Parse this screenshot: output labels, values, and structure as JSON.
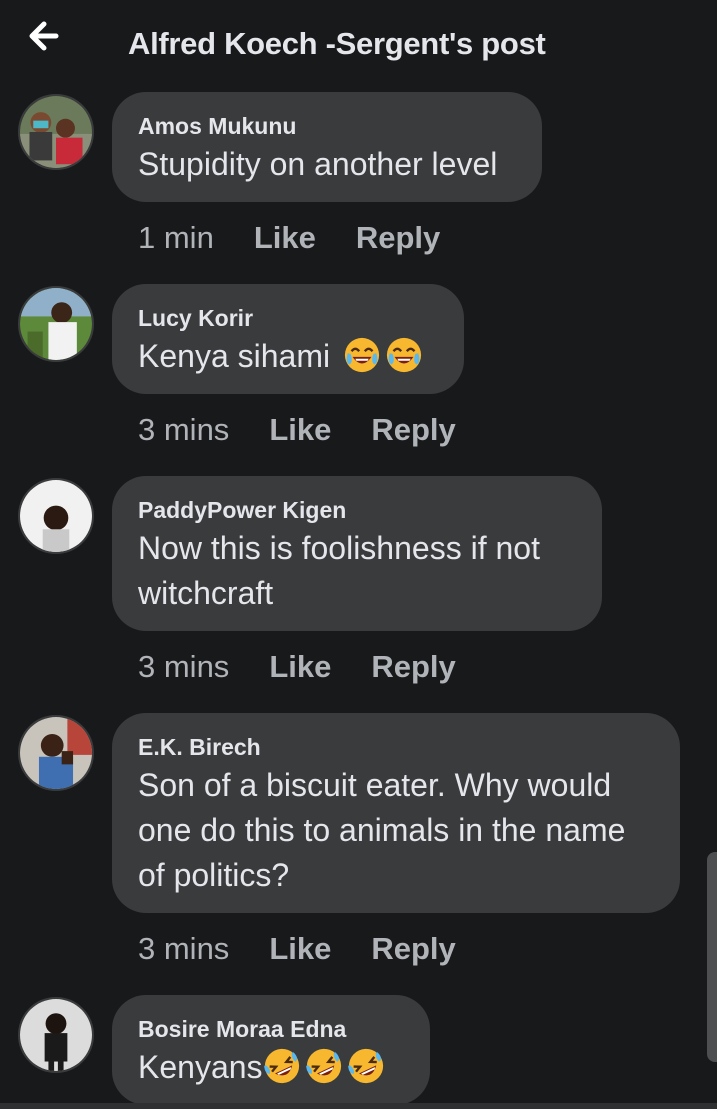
{
  "header": {
    "title": "Alfred Koech -Sergent's post"
  },
  "comments": [
    {
      "author": "Amos Mukunu",
      "text": "Stupidity on another level",
      "emojis": [],
      "time": "1 min",
      "like": "Like",
      "reply": "Reply"
    },
    {
      "author": "Lucy Korir",
      "text": "Kenya sihami",
      "emojis": [
        "tears-of-joy-emoji",
        "tears-of-joy-emoji"
      ],
      "time": "3 mins",
      "like": "Like",
      "reply": "Reply"
    },
    {
      "author": "PaddyPower Kigen",
      "text": "Now this is foolishness if not witchcraft",
      "emojis": [],
      "time": "3 mins",
      "like": "Like",
      "reply": "Reply"
    },
    {
      "author": "E.K. Birech",
      "text": "Son of a biscuit eater. Why would one do this to animals in the name of politics?",
      "emojis": [],
      "time": "3 mins",
      "like": "Like",
      "reply": "Reply"
    },
    {
      "author": "Bosire Moraa Edna",
      "text": "Kenyans",
      "emojis": [
        "rolling-laughing-emoji",
        "rolling-laughing-emoji",
        "rolling-laughing-emoji"
      ]
    }
  ],
  "icons": {
    "back": "back-arrow-icon"
  },
  "colors": {
    "background": "#18191a",
    "bubble": "#3a3b3c",
    "text": "#e4e6eb",
    "secondary": "#b0b3b8"
  }
}
